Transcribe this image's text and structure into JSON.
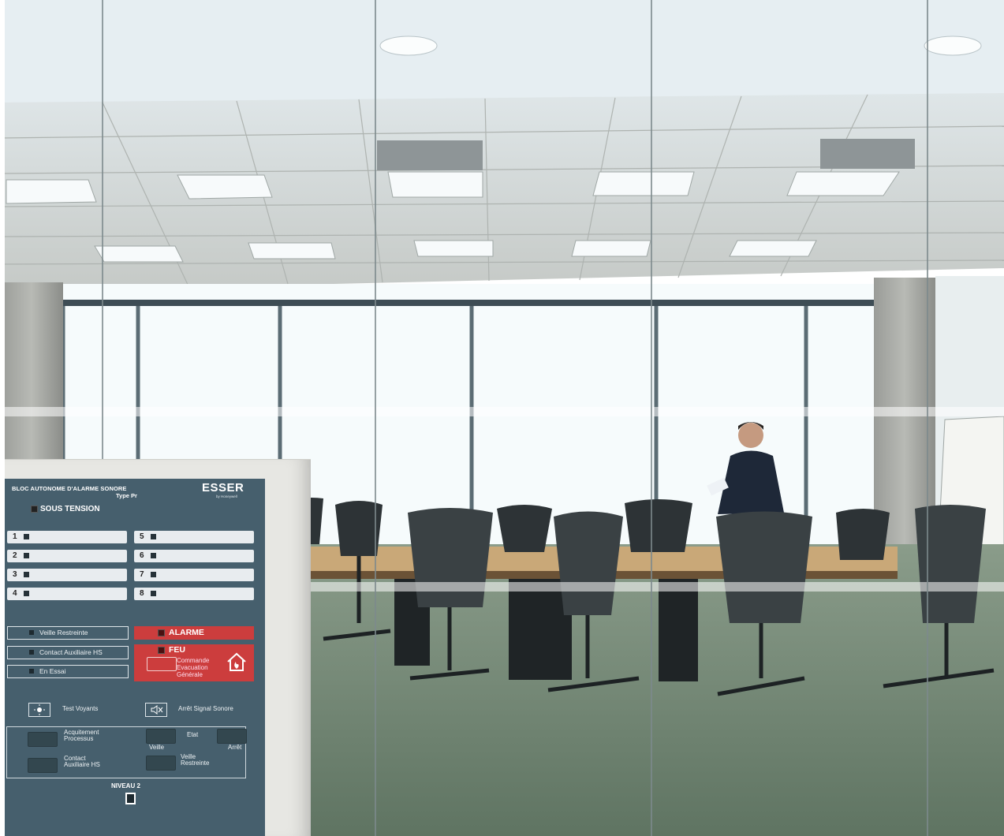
{
  "panel": {
    "header_line1": "BLOC AUTONOME D'ALARME SONORE",
    "header_line2": "Type Pr",
    "brand": "ESSER",
    "brand_sub": "by Honeywell",
    "power_label": "SOUS TENSION",
    "zones": [
      "1",
      "2",
      "3",
      "4",
      "5",
      "6",
      "7",
      "8"
    ],
    "status": [
      "Veille Restreinte",
      "Contact Auxiliaire HS",
      "En Essai"
    ],
    "alarm_label": "ALARME",
    "fire_label": "FEU",
    "command": [
      "Commande",
      "Evacuation",
      "Générale"
    ],
    "test_label": "Test Voyants",
    "silence_label": "Arrêt Signal Sonore",
    "ack": [
      "Acquitement",
      "Processus"
    ],
    "aux": [
      "Contact",
      "Auxiliaire HS"
    ],
    "etat_label": "Etat",
    "veille_label": "Veille",
    "arret_label": "Arrêt",
    "veille_r": [
      "Veille",
      "Restreinte"
    ],
    "level_label": "NIVEAU 2"
  },
  "colors": {
    "panel_bg": "#465f6d",
    "alarm_red": "#cc3d3d",
    "carpet": "#6f8270",
    "ceiling": "#cfd2cf"
  }
}
